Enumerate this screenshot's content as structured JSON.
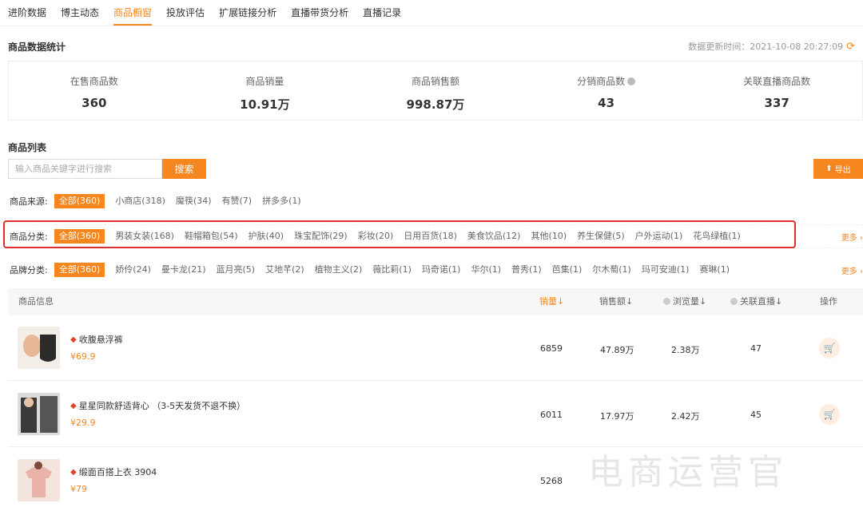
{
  "tabs": [
    "进阶数据",
    "博主动态",
    "商品橱窗",
    "投放评估",
    "扩展链接分析",
    "直播带货分析",
    "直播记录"
  ],
  "active_tab": "商品橱窗",
  "stats": {
    "title": "商品数据统计",
    "update_time": "数据更新时间：2021-10-08 20:27:09",
    "items": [
      {
        "label": "在售商品数",
        "value": "360"
      },
      {
        "label": "商品销量",
        "value": "10.91万"
      },
      {
        "label": "商品销售额",
        "value": "998.87万"
      },
      {
        "label": "分销商品数",
        "value": "43"
      },
      {
        "label": "关联直播商品数",
        "value": "337"
      }
    ]
  },
  "list": {
    "title": "商品列表",
    "search_placeholder": "输入商品关键字进行搜索",
    "search_label": "搜索",
    "export_label": "导出"
  },
  "filters": {
    "source": {
      "label": "商品来源:",
      "options": [
        "全部(360)",
        "小商店(318)",
        "魔筷(34)",
        "有赞(7)",
        "拼多多(1)"
      ]
    },
    "category": {
      "label": "商品分类:",
      "options": [
        "全部(360)",
        "男装女装(168)",
        "鞋帽箱包(54)",
        "护肤(40)",
        "珠宝配饰(29)",
        "彩妆(20)",
        "日用百货(18)",
        "美食饮品(12)",
        "其他(10)",
        "养生保健(5)",
        "户外运动(1)",
        "花鸟绿植(1)"
      ]
    },
    "brand": {
      "label": "品牌分类:",
      "options": [
        "全部(360)",
        "娇伶(24)",
        "曼卡龙(21)",
        "蓝月亮(5)",
        "艾地芊(2)",
        "植物主义(2)",
        "薇比莉(1)",
        "玛奇诺(1)",
        "华尔(1)",
        "普秀(1)",
        "芭集(1)",
        "尔木萄(1)",
        "玛可安迪(1)",
        "赛琳(1)"
      ]
    },
    "more_label": "更多"
  },
  "table": {
    "headers": {
      "info": "商品信息",
      "sales": "销量",
      "revenue": "销售额",
      "views": "浏览量",
      "live": "关联直播",
      "action": "操作"
    },
    "rows": [
      {
        "name": "收腹悬浮裤",
        "price": "¥69.9",
        "sales": "6859",
        "revenue": "47.89万",
        "views": "2.38万",
        "live": "47"
      },
      {
        "name": "星星同款舒适背心 （3-5天发货不退不换）",
        "price": "¥29.9",
        "sales": "6011",
        "revenue": "17.97万",
        "views": "2.42万",
        "live": "45"
      },
      {
        "name": "缎面百搭上衣 3904",
        "price": "¥79",
        "sales": "5268",
        "revenue": "",
        "views": "",
        "live": ""
      }
    ]
  },
  "watermark": "电商运营官"
}
